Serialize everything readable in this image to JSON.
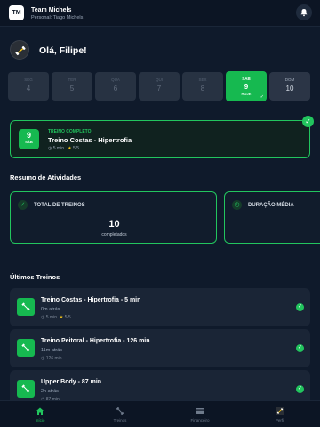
{
  "header": {
    "logo_text": "TM",
    "team_name": "Team Michels",
    "subtitle": "Personal: Tiago Michels"
  },
  "greeting": "Olá, Filipe!",
  "days": [
    {
      "name": "Seg",
      "date": "4"
    },
    {
      "name": "Ter",
      "date": "5"
    },
    {
      "name": "Qua",
      "date": "6"
    },
    {
      "name": "Qui",
      "date": "7"
    },
    {
      "name": "Sex",
      "date": "8"
    },
    {
      "name": "SÁB",
      "date": "9",
      "tag": "HOJE"
    },
    {
      "name": "DOM",
      "date": "10"
    }
  ],
  "completed_workout": {
    "day": "9",
    "weekday": "SÁB",
    "status": "TREINO COMPLETO",
    "title": "Treino Costas - Hipertrofia",
    "duration": "5 min",
    "rating": "5/5"
  },
  "summary": {
    "title": "Resumo de Atividades",
    "stats": [
      {
        "label": "TOTAL DE TREINOS",
        "value": "10",
        "sub": "completados"
      },
      {
        "label": "DURAÇÃO MÉDIA",
        "value": "",
        "sub": ""
      }
    ]
  },
  "recent": {
    "title": "Últimos Treinos",
    "items": [
      {
        "title": "Treino Costas - Hipertrofia - 5 min",
        "ago": "0m atrás",
        "duration": "5 min",
        "rating": "5/5"
      },
      {
        "title": "Treino Peitoral - Hipertrofia - 126 min",
        "ago": "11m atrás",
        "duration": "126 min",
        "rating": ""
      },
      {
        "title": "Upper Body - 87 min",
        "ago": "2h atrás",
        "duration": "87 min",
        "rating": ""
      }
    ]
  },
  "nav": [
    {
      "label": "Início",
      "icon": "home-icon",
      "active": true
    },
    {
      "label": "Treinos",
      "icon": "dumbbell-icon"
    },
    {
      "label": "Financeiro",
      "icon": "card-icon"
    },
    {
      "label": "Perfil",
      "icon": "profile-icon"
    }
  ],
  "colors": {
    "background": "#0f1a2b",
    "accent": "#22c55e",
    "star": "#f5c518"
  }
}
